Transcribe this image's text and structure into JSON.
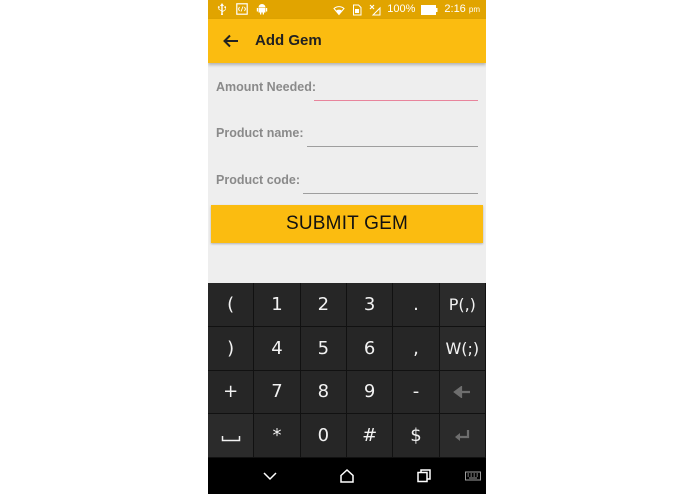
{
  "status_bar": {
    "battery_percent": "100%",
    "time": "2:16",
    "time_suffix": "pm"
  },
  "app_bar": {
    "title": "Add Gem"
  },
  "form": {
    "amount_label": "Amount Needed:",
    "amount_value": "",
    "product_name_label": "Product name:",
    "product_name_value": "",
    "product_code_label": "Product code:",
    "product_code_value": ""
  },
  "submit_label": "SUBMIT GEM",
  "keyboard": {
    "row1": [
      "(",
      "1",
      "2",
      "3",
      ".",
      "P(,)"
    ],
    "row2": [
      ")",
      "4",
      "5",
      "6",
      ",",
      "W(;)"
    ],
    "row3": [
      "+",
      "7",
      "8",
      "9",
      "-"
    ],
    "row4": [
      "*",
      "0",
      "#",
      "$"
    ]
  },
  "colors": {
    "accent": "#fbbc10",
    "status_bar": "#e1a400",
    "focus_underline": "#e8849c"
  }
}
